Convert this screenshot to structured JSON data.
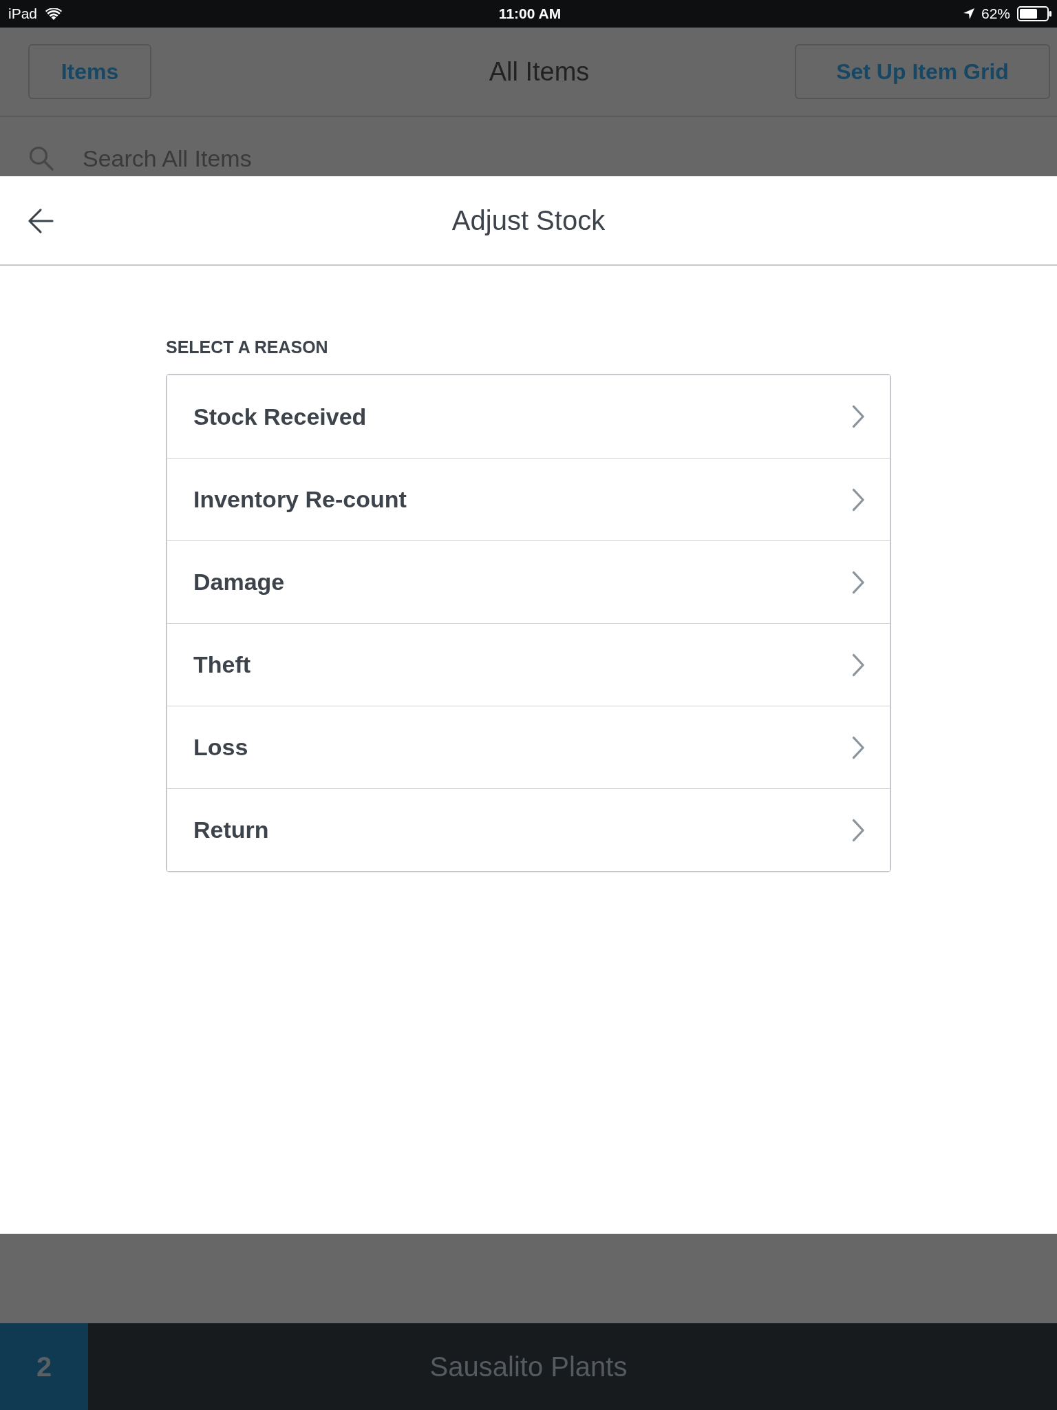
{
  "status_bar": {
    "device": "iPad",
    "time": "11:00 AM",
    "battery": "62%"
  },
  "background": {
    "header": {
      "left_button": "Items",
      "title": "All Items",
      "right_button": "Set Up Item Grid"
    },
    "search": {
      "placeholder": "Search All Items"
    },
    "footer": {
      "count": "2",
      "title": "Sausalito Plants"
    }
  },
  "modal": {
    "title": "Adjust Stock",
    "section_label": "SELECT A REASON",
    "reasons": [
      {
        "label": "Stock Received"
      },
      {
        "label": "Inventory Re-count"
      },
      {
        "label": "Damage"
      },
      {
        "label": "Theft"
      },
      {
        "label": "Loss"
      },
      {
        "label": "Return"
      }
    ]
  }
}
